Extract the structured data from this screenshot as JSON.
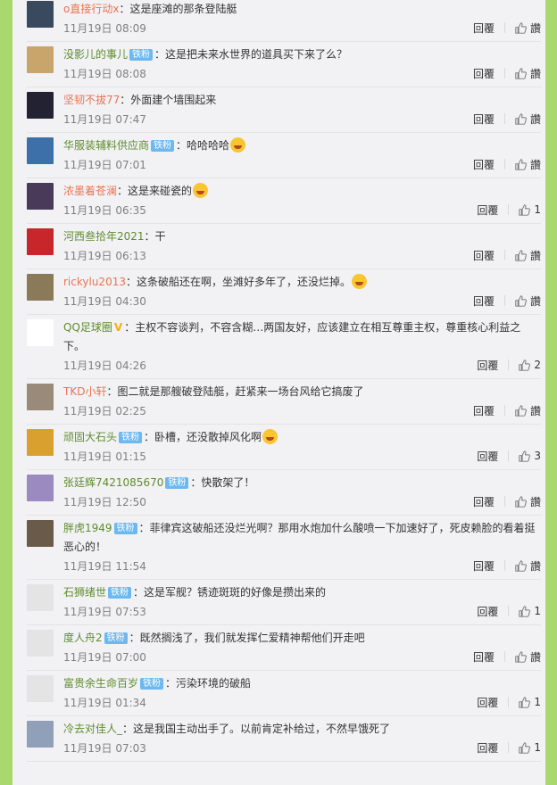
{
  "reply_label": "回覆",
  "like_label": "讚",
  "badge_label": "铁粉",
  "comments": [
    {
      "user": "o直接行动x",
      "badge": false,
      "text": "：这是座滩的那条登陆艇",
      "time": "11月19日 08:09",
      "likes": "",
      "avatar": "#3a4a5e"
    },
    {
      "user": "没影儿的事儿",
      "badge": true,
      "text": "：这是把未来水世界的道具买下来了么？",
      "time": "11月19日 08:08",
      "likes": "",
      "avatar": "#c8a56a"
    },
    {
      "user": "坚韧不拔77",
      "badge": false,
      "text": "：外面建个墙围起来",
      "time": "11月19日 07:47",
      "likes": "",
      "avatar": "#222233"
    },
    {
      "user": "华服装辅料供应商",
      "badge": true,
      "text": "：哈哈哈哈",
      "emoji": true,
      "time": "11月19日 07:01",
      "likes": "",
      "avatar": "#3d6fa8"
    },
    {
      "user": "浓墨着苍澜",
      "badge": false,
      "text": "：这是来碰瓷的",
      "emoji": true,
      "time": "11月19日 06:35",
      "likes": "1",
      "avatar": "#4a3a5a"
    },
    {
      "user": "河西叁拾年2021",
      "badge": false,
      "text": "：干",
      "time": "11月19日 06:13",
      "likes": "",
      "avatar": "#c7262a"
    },
    {
      "user": "rickylu2013",
      "badge": false,
      "text": "：这条破船还在啊，坐滩好多年了，还没烂掉。",
      "emoji": true,
      "time": "11月19日 04:30",
      "likes": "",
      "avatar": "#8a7a5a"
    },
    {
      "user": "QQ足球圈",
      "vip": true,
      "badge": false,
      "text": "：主权不容谈判，不容含糊…两国友好，应该建立在相互尊重主权，尊重核心利益之下。",
      "time": "11月19日 04:26",
      "likes": "2",
      "avatar": "#ffffff"
    },
    {
      "user": "TKD小轩",
      "badge": false,
      "text": "：图二就是那艘破登陆艇，赶紧来一场台风给它搞废了",
      "time": "11月19日 02:25",
      "likes": "",
      "avatar": "#9a8a7a"
    },
    {
      "user": "顽固大石头",
      "badge": true,
      "text": "：卧槽，还没散掉风化啊",
      "emoji": true,
      "time": "11月19日 01:15",
      "likes": "3",
      "avatar": "#d9a030"
    },
    {
      "user": "张廷辉7421085670",
      "badge": true,
      "text": "：快散架了！",
      "time": "11月19日 12:50",
      "likes": "",
      "avatar": "#9a8ac0"
    },
    {
      "user": "胖虎1949",
      "badge": true,
      "text": "：菲律宾这破船还没烂光啊？那用水炮加什么酸喷一下加速好了，死皮赖脸的看着挺恶心的！",
      "time": "11月19日 11:54",
      "likes": "",
      "avatar": "#6a5a4a"
    },
    {
      "user": "石狮绪世",
      "badge": true,
      "text": "：这是军舰？锈迹斑斑的好像是攒出来的",
      "time": "11月19日 07:53",
      "likes": "1",
      "avatar": "#e4e4e4"
    },
    {
      "user": "度人舟2",
      "badge": true,
      "text": "：既然搁浅了，我们就发挥仁爱精神帮他们开走吧",
      "time": "11月19日 07:00",
      "likes": "",
      "avatar": "#e4e4e4"
    },
    {
      "user": "富贵余生命百岁",
      "badge": true,
      "text": "：污染环境的破船",
      "time": "11月19日 01:34",
      "likes": "1",
      "avatar": "#e4e4e4"
    },
    {
      "user": "冷去对佳人_",
      "badge": false,
      "text": "：这是我国主动出手了。以前肯定补给过，不然早饿死了",
      "time": "11月19日 07:03",
      "likes": "1",
      "avatar": "#8fa0b8"
    }
  ]
}
